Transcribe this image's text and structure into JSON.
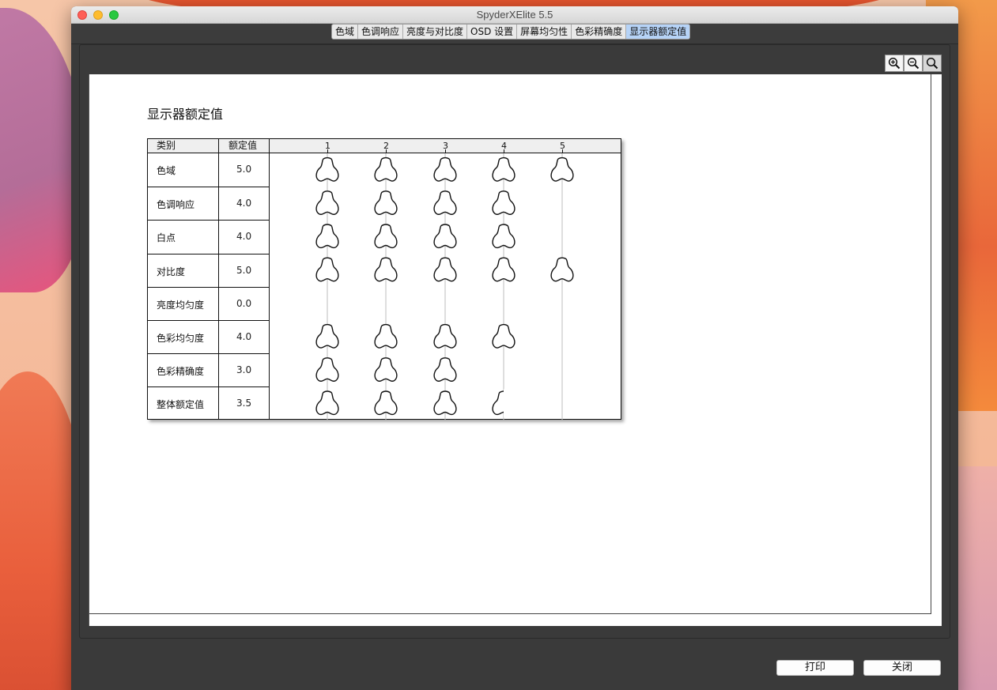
{
  "window": {
    "title": "SpyderXElite 5.5"
  },
  "tabs": [
    {
      "label": "色域",
      "active": false
    },
    {
      "label": "色调响应",
      "active": false
    },
    {
      "label": "亮度与对比度",
      "active": false
    },
    {
      "label": "OSD 设置",
      "active": false
    },
    {
      "label": "屏幕均匀性",
      "active": false
    },
    {
      "label": "色彩精确度",
      "active": false
    },
    {
      "label": "显示器额定值",
      "active": true
    }
  ],
  "zoom": {
    "zoom_in_icon": "zoom-in-icon",
    "zoom_out_icon": "zoom-out-icon",
    "zoom_reset_icon": "zoom-reset-icon"
  },
  "report": {
    "title": "显示器额定值",
    "header": {
      "category": "类别",
      "rating": "额定值",
      "scale": [
        "1",
        "2",
        "3",
        "4",
        "5"
      ]
    },
    "rows": [
      {
        "category": "色域",
        "rating": "5.0",
        "value": 5.0
      },
      {
        "category": "色调响应",
        "rating": "4.0",
        "value": 4.0
      },
      {
        "category": "白点",
        "rating": "4.0",
        "value": 4.0
      },
      {
        "category": "对比度",
        "rating": "5.0",
        "value": 5.0
      },
      {
        "category": "亮度均匀度",
        "rating": "0.0",
        "value": 0.0
      },
      {
        "category": "色彩均匀度",
        "rating": "4.0",
        "value": 4.0
      },
      {
        "category": "色彩精确度",
        "rating": "3.0",
        "value": 3.0
      },
      {
        "category": "整体额定值",
        "rating": "3.5",
        "value": 3.5
      }
    ],
    "icon": "spyder-icon"
  },
  "buttons": {
    "print": "打印",
    "close": "关闭"
  }
}
